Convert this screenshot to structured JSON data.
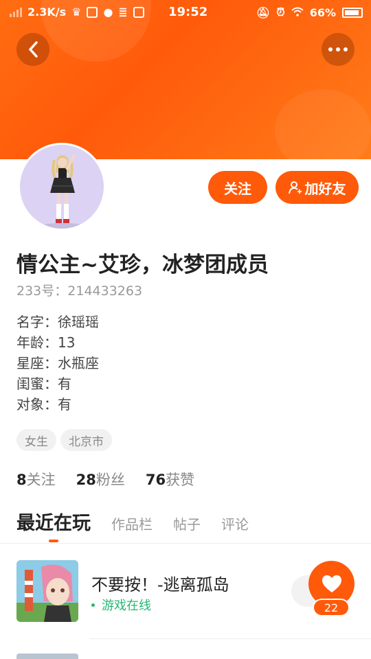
{
  "status_bar": {
    "speed": "2.3K/s",
    "time": "19:52",
    "battery": "66%"
  },
  "profile": {
    "nickname": "情公主~艾珍，冰梦团成员",
    "uid": "233号：214433263",
    "bio": [
      "名字：徐瑶瑶",
      "年龄：13",
      "星座：水瓶座",
      "闺蜜：有",
      "对象：有"
    ],
    "tags": [
      "女生",
      "北京市"
    ],
    "stats": [
      {
        "value": "8",
        "label": "关注"
      },
      {
        "value": "28",
        "label": "粉丝"
      },
      {
        "value": "76",
        "label": "获赞"
      }
    ]
  },
  "actions": {
    "follow_label": "关注",
    "add_friend_label": "加好友"
  },
  "tabs": [
    "最近在玩",
    "作品栏",
    "帖子",
    "评论"
  ],
  "game": {
    "title": "不要按！-逃离孤岛",
    "status": "游戏在线"
  },
  "fab": {
    "count": "22"
  },
  "colors": {
    "accent": "#ff5a0a",
    "online": "#25b872"
  }
}
